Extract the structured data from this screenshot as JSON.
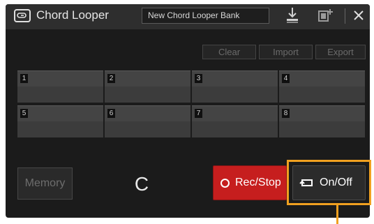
{
  "window": {
    "title": "Chord Looper",
    "bank_name": "New Chord Looper Bank"
  },
  "toolbar": {
    "icons": [
      "download-icon",
      "add-bank-icon",
      "close-icon"
    ]
  },
  "actions": {
    "clear": "Clear",
    "import": "Import",
    "export": "Export"
  },
  "memory_cells": [
    {
      "number": "1"
    },
    {
      "number": "2"
    },
    {
      "number": "3"
    },
    {
      "number": "4"
    },
    {
      "number": "5"
    },
    {
      "number": "6"
    },
    {
      "number": "7"
    },
    {
      "number": "8"
    }
  ],
  "controls": {
    "memory": "Memory",
    "chord": "C",
    "rec_stop": "Rec/Stop",
    "on_off": "On/Off"
  },
  "colors": {
    "rec_button": "#c61e1e",
    "highlight": "#f0a020",
    "background": "#1b1b1b"
  }
}
